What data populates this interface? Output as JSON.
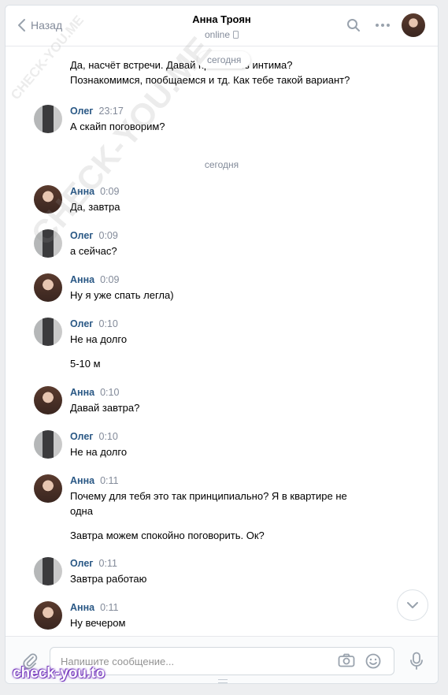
{
  "header": {
    "back_label": "Назад",
    "title": "Анна Троян",
    "status": "online"
  },
  "floating_date": "сегодня",
  "messages_top": {
    "line1": "Да, насчёт встречи. Давай просто без интима?",
    "line2": "Познакомимся, пообщаемся и тд. Как тебе такой вариант?"
  },
  "oleg_first": {
    "author": "Олег",
    "time": "23:17",
    "text": "А скайп поговорим?"
  },
  "date_separator": "сегодня",
  "messages": [
    {
      "author": "Анна",
      "time": "0:09",
      "text": "Да, завтра"
    },
    {
      "author": "Олег",
      "time": "0:09",
      "text": "а сейчас?"
    },
    {
      "author": "Анна",
      "time": "0:09",
      "text": "Ну я уже спать легла)"
    },
    {
      "author": "Олег",
      "time": "0:10",
      "text": "Не на долго",
      "text2": "5-10 м"
    },
    {
      "author": "Анна",
      "time": "0:10",
      "text": "Давай завтра?"
    },
    {
      "author": "Олег",
      "time": "0:10",
      "text": "Не на долго"
    },
    {
      "author": "Анна",
      "time": "0:11",
      "text": "Почему для тебя это так принципиально? Я в квартире не одна",
      "text2": "Завтра можем спокойно поговорить. Ок?"
    },
    {
      "author": "Олег",
      "time": "0:11",
      "text": "Завтра работаю"
    },
    {
      "author": "Анна",
      "time": "0:11",
      "text": "Ну вечером"
    }
  ],
  "composer": {
    "placeholder": "Напишите сообщение..."
  },
  "watermark": {
    "text": "CHECK-YOU.ME",
    "brand": "check-you.to"
  },
  "colors": {
    "author": "#2a5885",
    "muted": "#828a99",
    "brand_glow": "#7a3fbf"
  },
  "icons": [
    "chevron-left-icon",
    "search-icon",
    "more-icon",
    "phone-icon",
    "chevron-down-icon",
    "paperclip-icon",
    "camera-icon",
    "smile-icon",
    "microphone-icon"
  ]
}
